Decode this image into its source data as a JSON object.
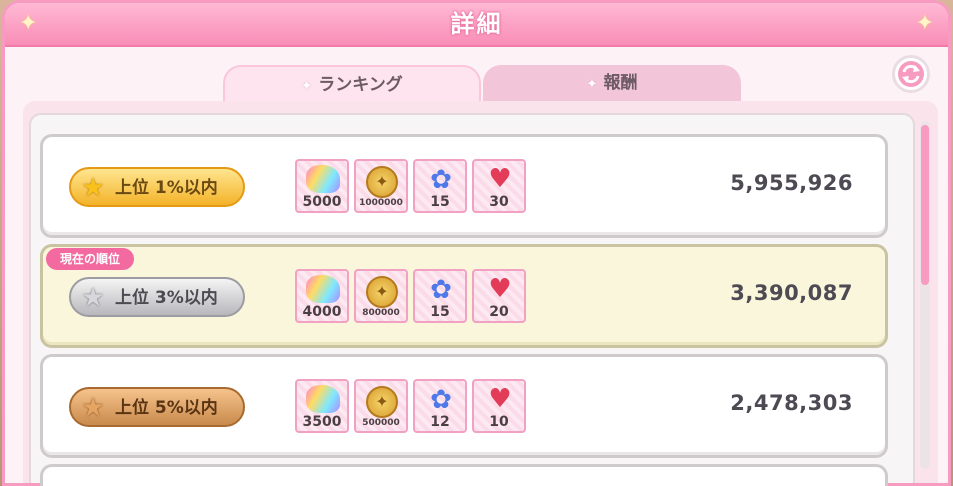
{
  "dialog": {
    "title": "詳細"
  },
  "tabs": [
    {
      "label": "ランキング",
      "active": true
    },
    {
      "label": "報酬",
      "active": false
    }
  ],
  "current_rank_label": "現在の順位",
  "rows": [
    {
      "tier": "gold",
      "rank_label": "上位 1%以内",
      "items": [
        {
          "icon": "rainbow-gem-icon",
          "qty": "5000"
        },
        {
          "icon": "gold-coin-icon",
          "qty": "1000000"
        },
        {
          "icon": "blue-rose-icon",
          "qty": "15"
        },
        {
          "icon": "heart-bouquet-icon",
          "qty": "30"
        }
      ],
      "points": "5,955,926",
      "is_current": false
    },
    {
      "tier": "silver",
      "rank_label": "上位 3%以内",
      "items": [
        {
          "icon": "rainbow-gem-icon",
          "qty": "4000"
        },
        {
          "icon": "gold-coin-icon",
          "qty": "800000"
        },
        {
          "icon": "blue-rose-icon",
          "qty": "15"
        },
        {
          "icon": "heart-bouquet-icon",
          "qty": "20"
        }
      ],
      "points": "3,390,087",
      "is_current": true
    },
    {
      "tier": "bronze",
      "rank_label": "上位 5%以内",
      "items": [
        {
          "icon": "rainbow-gem-icon",
          "qty": "3500"
        },
        {
          "icon": "gold-coin-icon",
          "qty": "500000"
        },
        {
          "icon": "blue-rose-icon",
          "qty": "12"
        },
        {
          "icon": "heart-bouquet-icon",
          "qty": "10"
        }
      ],
      "points": "2,478,303",
      "is_current": false
    }
  ],
  "colors": {
    "title_bar": "#f98db7",
    "current_row_bg": "#f9f6dc",
    "current_tag": "#f26aa0"
  }
}
